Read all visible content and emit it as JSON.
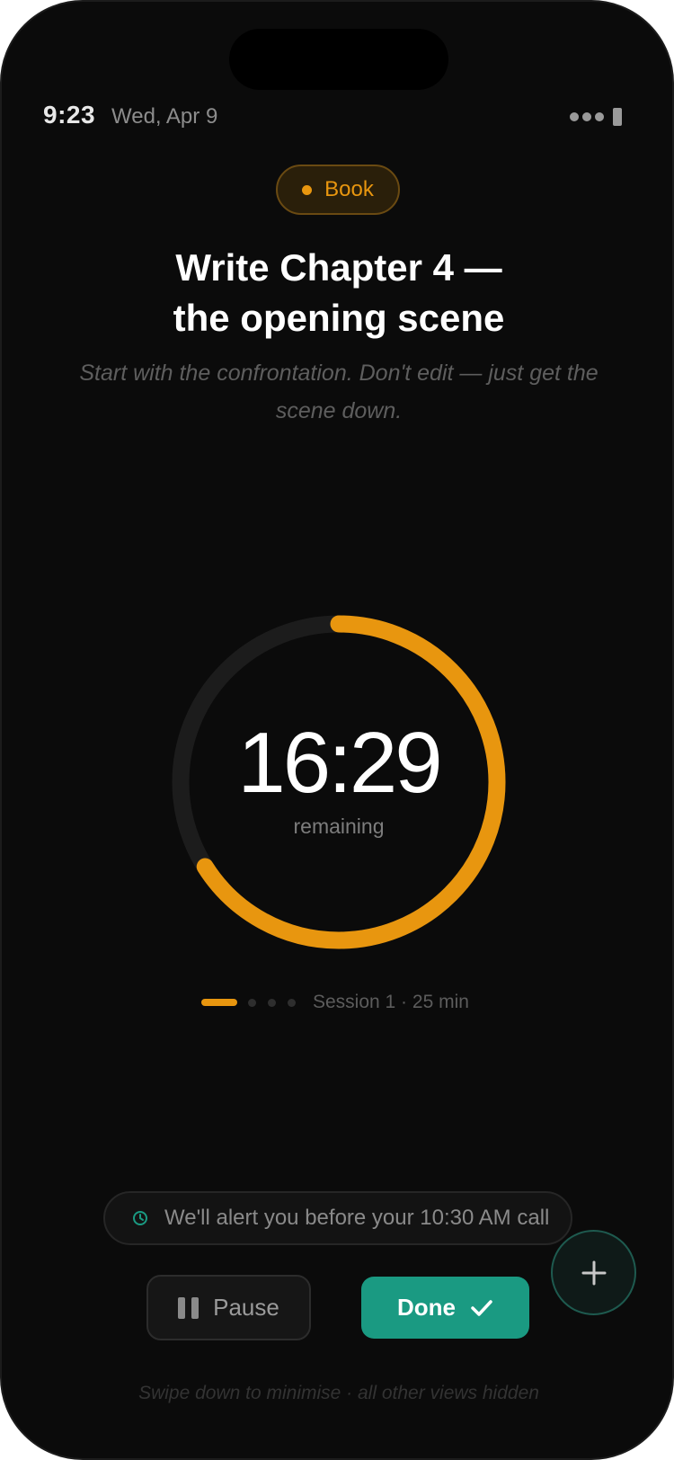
{
  "status_bar": {
    "time": "9:23",
    "date": "Wed, Apr 9"
  },
  "task": {
    "tag": "Book",
    "title": "Write Chapter 4 — the opening scene",
    "note": "Start with the confrontation. Don't edit — just get the scene down."
  },
  "timer": {
    "value": "16:29",
    "caption": "remaining",
    "progress_remaining": 0.66
  },
  "session": {
    "label": "Session 1 · 25 min",
    "current": 1,
    "total": 4
  },
  "alert": {
    "text": "We'll alert you before your 10:30 AM call"
  },
  "actions": {
    "pause_label": "Pause",
    "done_label": "Done"
  },
  "footer": {
    "hint": "Swipe down to minimise · all other views hidden"
  },
  "colors": {
    "background": "#0b0b0b",
    "accent": "#e8960f",
    "success": "#1a9a82",
    "track": "#1c1c1c"
  },
  "icons": {
    "tag": "dot-icon",
    "alert": "clock-icon",
    "fab": "plus-icon",
    "pause": "pause-icon",
    "done": "checkmark-icon"
  }
}
